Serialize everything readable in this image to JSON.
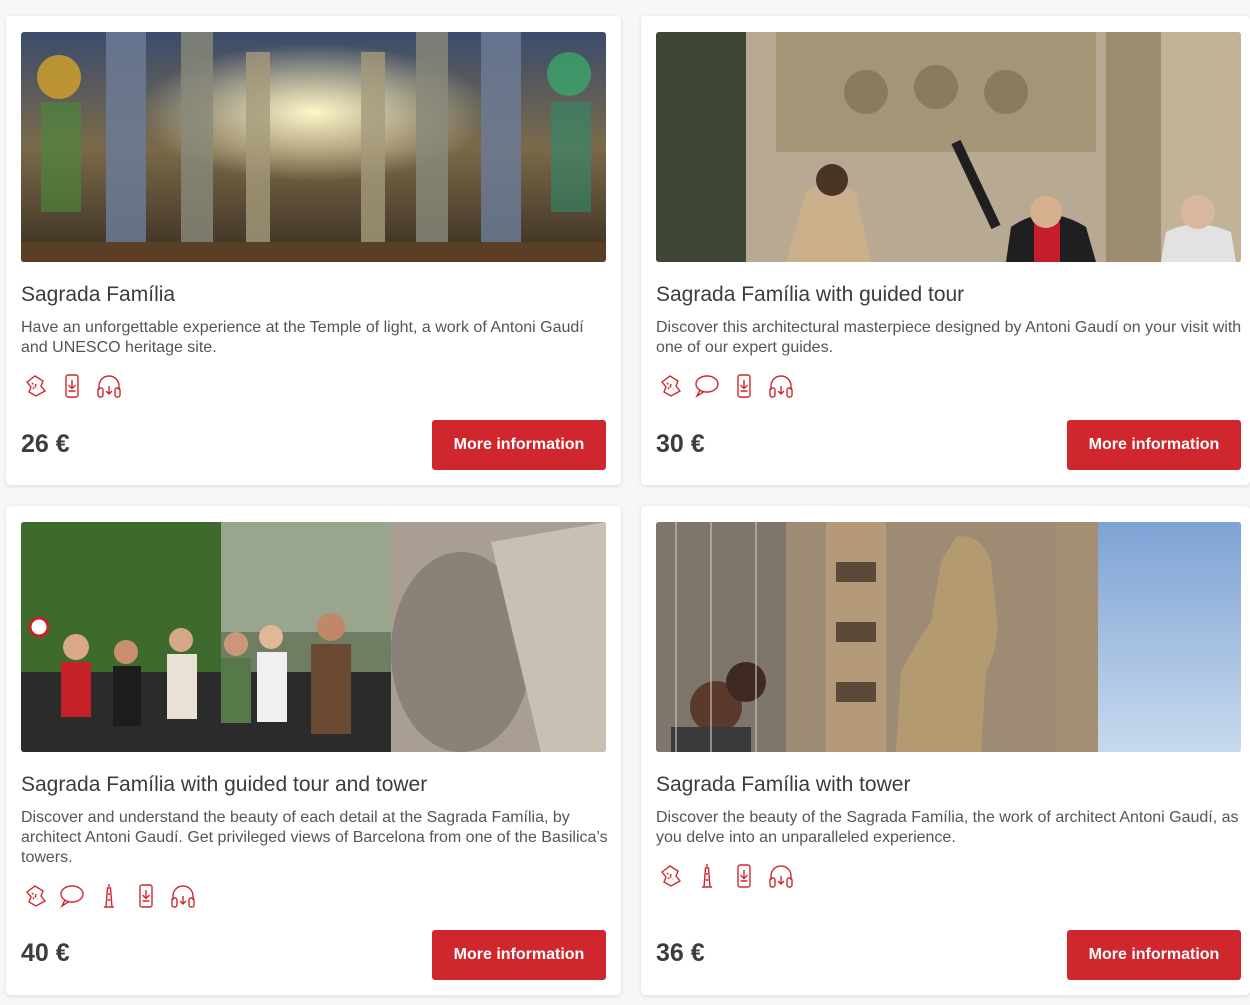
{
  "colors": {
    "accent": "#d0272f",
    "card_bg": "#ffffff",
    "page_bg": "#f7f7f7",
    "icon": "#d0272f"
  },
  "cards": [
    {
      "photo": "Sagrada Família interior nave with stained glass",
      "title": "Sagrada Família",
      "description": "Have an unforgettable experience at the Temple of light, a work of Antoni Gaudí and UNESCO heritage site.",
      "icons": [
        "ticket-icon",
        "mobile-download-icon",
        "audioguide-icon"
      ],
      "price": "26 €",
      "button_label": "More information"
    },
    {
      "photo": "Guide pointing at sculpted facade",
      "title": "Sagrada Família with guided tour",
      "description": "Discover this architectural masterpiece designed by Antoni Gaudí on your visit with one of our expert guides.",
      "icons": [
        "ticket-icon",
        "speech-bubble-icon",
        "mobile-download-icon",
        "audioguide-icon"
      ],
      "price": "30 €",
      "button_label": "More information"
    },
    {
      "photo": "Tour group looking up at the basilica",
      "title": "Sagrada Família with guided tour and tower",
      "description": "Discover and understand the beauty of each detail at the Sagrada Família, by architect Antoni Gaudí. Get privileged views of Barcelona from one of the Basilica’s towers.",
      "icons": [
        "ticket-icon",
        "speech-bubble-icon",
        "tower-icon",
        "mobile-download-icon",
        "audioguide-icon"
      ],
      "price": "40 €",
      "button_label": "More information"
    },
    {
      "photo": "Visitors beside a stone sculpture in the tower",
      "title": "Sagrada Família with tower",
      "description": "Discover the beauty of the Sagrada Família, the work of architect Antoni Gaudí, as you delve into an unparalleled experience.",
      "icons": [
        "ticket-icon",
        "tower-icon",
        "mobile-download-icon",
        "audioguide-icon"
      ],
      "price": "36 €",
      "button_label": "More information"
    }
  ]
}
